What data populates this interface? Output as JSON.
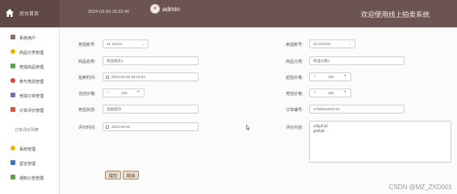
{
  "header": {
    "system_label": "后台首页",
    "datetime": "2024-03-03 16:33:46",
    "username": "admin",
    "site_title": "欢迎使用线上拍卖系统"
  },
  "sidebar": {
    "items": [
      {
        "label": "系统用户",
        "icon": "user-icon",
        "color": "#8f6f6a"
      },
      {
        "label": "商品分类管理",
        "icon": "category-icon",
        "color": "#e2b900"
      },
      {
        "label": "竞拍商品管理",
        "icon": "goods-icon",
        "color": "#5aa24c"
      },
      {
        "label": "参与竞拍管理",
        "icon": "bid-icon",
        "color": "#d04a3c"
      },
      {
        "label": "竞拍订单管理",
        "icon": "order-icon",
        "color": "#7a6fb3"
      },
      {
        "label": "订单评价管理",
        "icon": "review-icon",
        "color": "#d25a3e"
      },
      {
        "label": "订单评价列表",
        "icon": "",
        "color": ""
      },
      {
        "label": "系统管理",
        "icon": "settings-icon",
        "color": "#e2b900"
      },
      {
        "label": "留言管理",
        "icon": "message-icon",
        "color": "#3f74c4"
      },
      {
        "label": "通知公告管理",
        "icon": "notice-icon",
        "color": "#5aa24c"
      }
    ]
  },
  "form": {
    "bidder_account": {
      "label": "竞拍账号:",
      "value": "11 111111"
    },
    "seller_account": {
      "label": "卖拍账号:",
      "value": "22 222222"
    },
    "product_name": {
      "label": "商品名称:",
      "value": "商品拍卖1"
    },
    "product_category": {
      "label": "商品分类:",
      "value": "商品分类1"
    },
    "auction_time": {
      "label": "拍卖时间:",
      "value": "2024-03-03 16:16:53"
    },
    "starting_price": {
      "label": "起拍价格:",
      "value": "100"
    },
    "current_price": {
      "label": "当前价格:",
      "value": "100"
    },
    "bid_price": {
      "label": "竞拍价格:",
      "value": "100"
    },
    "bid_status": {
      "label": "竞拍状态:",
      "value": "竞拍成功"
    },
    "order_number": {
      "label": "订单编号:",
      "value": "1709454916742"
    },
    "review_time": {
      "label": "评价时间:",
      "value": "2024-03-03"
    },
    "review_content": {
      "label": "评价内容:",
      "lines": [
        "sdfgdf jkl",
        "ghdkjkl"
      ]
    }
  },
  "buttons": {
    "submit": "提交",
    "cancel": "取消"
  },
  "watermark": "CSDN @MZ_ZXD001",
  "colors": {
    "header_bg": "#6b5451",
    "button_bg": "#e8dcc8"
  }
}
